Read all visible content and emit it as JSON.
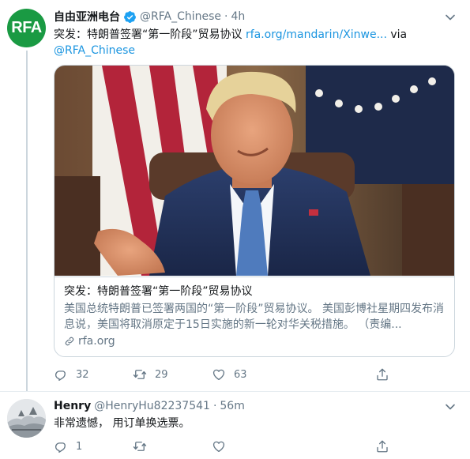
{
  "tweet1": {
    "author_name": "自由亚洲电台",
    "avatar_text": "RFA",
    "handle": "@RFA_Chinese",
    "separator": "·",
    "time": "4h",
    "text_main": "突发：特朗普签署“第一阶段”贸易协议 ",
    "text_link": "rfa.org/mandarin/Xinwe...",
    "text_via": " via",
    "text_mention": "@RFA_Chinese",
    "card": {
      "title": "突发：特朗普签署“第一阶段”贸易协议",
      "description": "美国总统特朗普已签署两国的“第一阶段”贸易协议。 美国彭博社星期四发布消息说，美国将取消原定于15日实施的新一轮对华关税措施。 （责编...",
      "domain": "rfa.org"
    },
    "actions": {
      "replies": "32",
      "retweets": "29",
      "likes": "63"
    }
  },
  "tweet2": {
    "author_name": "Henry",
    "handle": "@HenryHu82237541",
    "separator": "·",
    "time": "56m",
    "text": "非常遗憾， 用订单换选票。",
    "actions": {
      "replies": "1",
      "retweets": "",
      "likes": ""
    }
  },
  "colors": {
    "link": "#1b95e0",
    "verified": "#1da1f2",
    "muted": "#657786",
    "rfa_green": "#1a9a43"
  },
  "icons": [
    "verified-icon",
    "chevron-down-icon",
    "link-icon",
    "reply-icon",
    "retweet-icon",
    "like-icon",
    "share-icon"
  ]
}
